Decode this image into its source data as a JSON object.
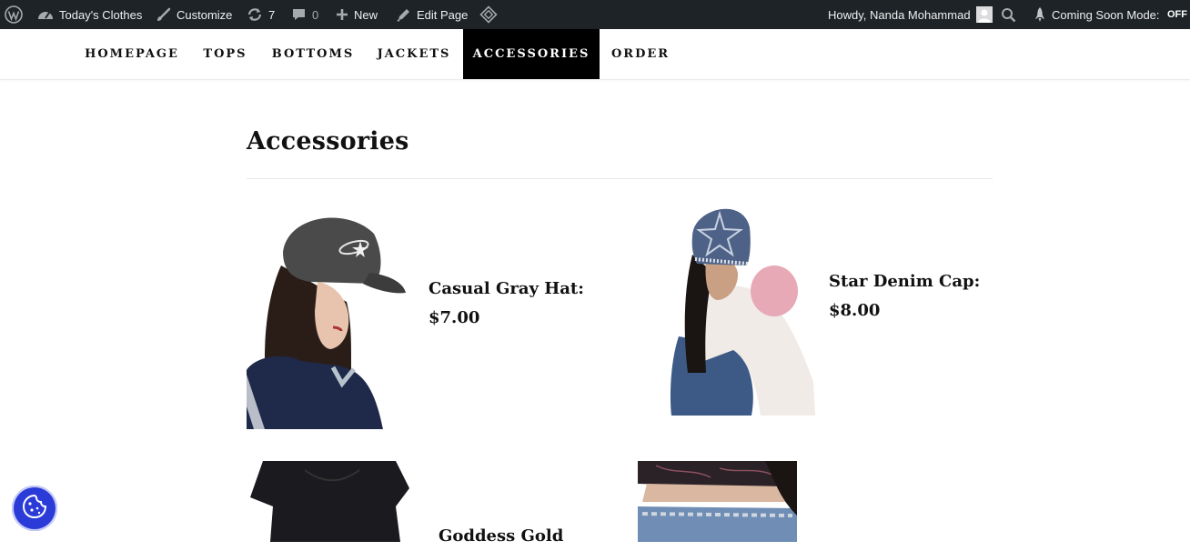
{
  "adminbar": {
    "site_name": "Today's Clothes",
    "customize": "Customize",
    "updates_count": "7",
    "comments_count": "0",
    "new": "New",
    "edit_page": "Edit Page",
    "howdy": "Howdy, Nanda Mohammad",
    "coming_soon_label": "Coming Soon Mode:",
    "coming_soon_state": "OFF"
  },
  "nav": {
    "items": [
      {
        "label": "HOMEPAGE"
      },
      {
        "label": "TOPS"
      },
      {
        "label": "BOTTOMS"
      },
      {
        "label": "JACKETS"
      },
      {
        "label": "ACCESSORIES",
        "active": true
      },
      {
        "label": "ORDER"
      }
    ]
  },
  "page": {
    "title": "Accessories",
    "products": [
      {
        "name": "Casual Gray Hat:",
        "price": "$7.00"
      },
      {
        "name": "Star Denim Cap:",
        "price": "$8.00"
      },
      {
        "name": "Goddess Gold",
        "price": ""
      },
      {
        "name": "",
        "price": ""
      }
    ]
  },
  "colors": {
    "adminbar_bg": "#1d2327",
    "active_nav_bg": "#000000",
    "cookie_button": "#2a3bd8"
  }
}
